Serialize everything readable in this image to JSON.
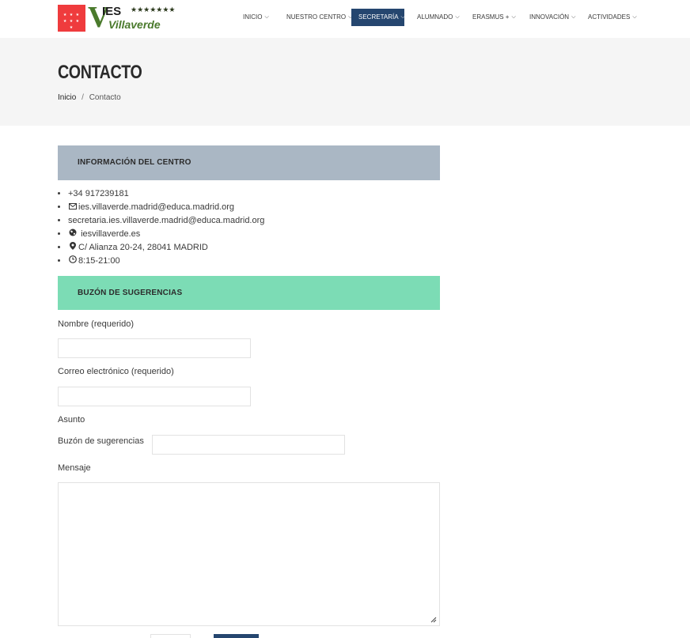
{
  "header": {
    "logo_flag_stars": "★ ★ ★ ★ ★ ★ ★",
    "logo_v": "V",
    "logo_ies": "IES",
    "logo_stars": "★★★★★★★",
    "logo_villa": "Villaverde",
    "nav": [
      {
        "label": "INICIO",
        "active": false
      },
      {
        "label": "NUESTRO CENTRO",
        "active": false
      },
      {
        "label": "SECRETARÍA",
        "active": true
      },
      {
        "label": "ALUMNADO",
        "active": false
      },
      {
        "label": "ERASMUS +",
        "active": false
      },
      {
        "label": "INNOVACIÓN",
        "active": false
      },
      {
        "label": "ACTIVIDADES",
        "active": false
      }
    ]
  },
  "page": {
    "title": "CONTACTO",
    "breadcrumb_home": "Inicio",
    "breadcrumb_sep": "/",
    "breadcrumb_current": "Contacto"
  },
  "info": {
    "heading": "INFORMACIÓN DEL CENTRO",
    "phone": "+34 917239181",
    "email": "ies.villaverde.madrid@educa.madrid.org",
    "email_secretaria": "secretaria.ies.villaverde.madrid@educa.madrid.org",
    "web": "iesvillaverde.es",
    "address": "C/ Alianza 20-24, 28041 MADRID",
    "hours": "8:15-21:00"
  },
  "form": {
    "heading": "BUZÓN DE SUGERENCIAS",
    "name_label": "Nombre (requerido)",
    "name_value": "",
    "email_label": "Correo electrónico (requerido)",
    "email_value": "",
    "subject_label": "Asunto",
    "subject_field_label": "Buzón de sugerencias",
    "subject_value": "",
    "message_label": "Mensaje",
    "message_value": ""
  },
  "colors": {
    "nav_active": "#25466f",
    "info_heading_bg": "#aab7c4",
    "form_heading_bg": "#7cdcb5",
    "flag_red": "#ef3b3d",
    "logo_green": "#4a7a2c"
  }
}
